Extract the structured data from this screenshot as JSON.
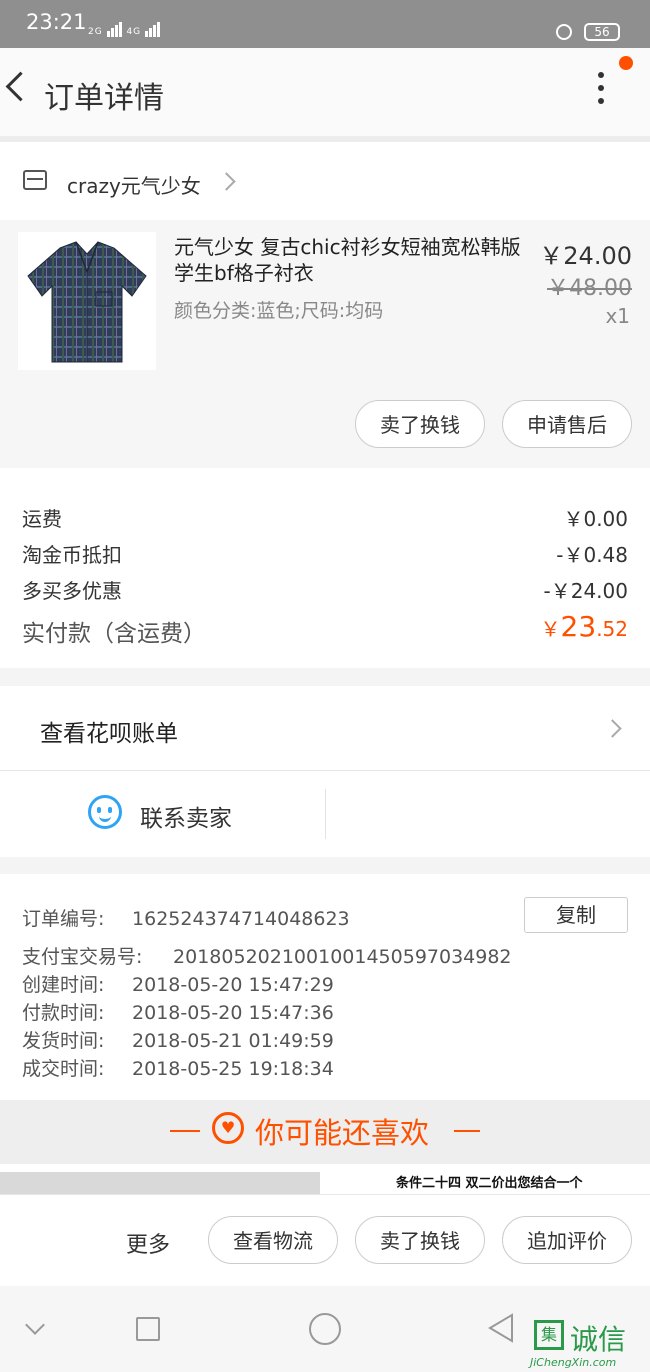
{
  "status_bar": {
    "time": "23:21",
    "network_1": "2G",
    "network_2": "4G",
    "battery": "56"
  },
  "header": {
    "title": "订单详情"
  },
  "shop": {
    "name": "crazy元气少女"
  },
  "product": {
    "name": "元气少女 复古chic衬衫女短袖宽松韩版学生bf格子衬衣",
    "sku": "颜色分类:蓝色;尺码:均码",
    "price": "￥24.00",
    "original_price": "￥48.00",
    "quantity": "x1",
    "buttons": [
      "卖了换钱",
      "申请售后"
    ]
  },
  "fees": {
    "rows": [
      {
        "label": "运费",
        "value": "￥0.00"
      },
      {
        "label": "淘金币抵扣",
        "value": "-￥0.48"
      },
      {
        "label": "多买多优惠",
        "value": "-￥24.00"
      }
    ],
    "total_label": "实付款（含运费）",
    "total_symbol": "￥",
    "total_int": "23",
    "total_dec": ".52",
    "accent_color": "#ff5000"
  },
  "huabei": {
    "label": "查看花呗账单"
  },
  "contact": {
    "label": "联系卖家"
  },
  "order_info": {
    "rows": [
      {
        "label": "订单编号:",
        "value": "162524374714048623"
      },
      {
        "label": "支付宝交易号:",
        "value": "2018052021001001450597034982"
      },
      {
        "label": "创建时间:",
        "value": "2018-05-20 15:47:29"
      },
      {
        "label": "付款时间:",
        "value": "2018-05-20 15:47:36"
      },
      {
        "label": "发货时间:",
        "value": "2018-05-21 01:49:59"
      },
      {
        "label": "成交时间:",
        "value": "2018-05-25 19:18:34"
      }
    ],
    "copy_label": "复制"
  },
  "recommend": {
    "title": "你可能还喜欢",
    "strip_text": "条件二十四  双二价出您结合一个"
  },
  "actions": {
    "more": "更多",
    "buttons": [
      "查看物流",
      "卖了换钱",
      "追加评价"
    ]
  },
  "watermark": {
    "text": "诚信",
    "url": "JiChengXin.com"
  },
  "icons": {
    "back": "back-arrow-icon",
    "more": "more-vertical-icon",
    "shop": "shop-icon",
    "contact": "smile-chat-icon",
    "heart": "heart-icon"
  }
}
